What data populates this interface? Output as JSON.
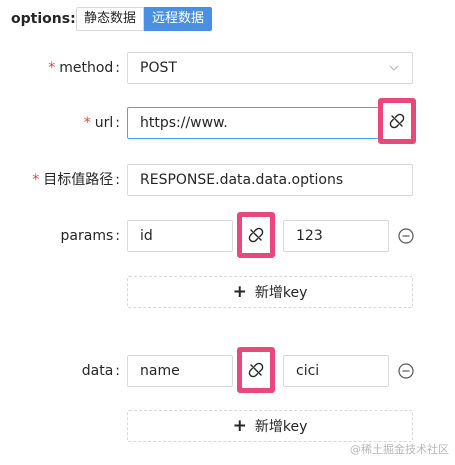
{
  "options": {
    "label": "options",
    "segments": [
      "静态数据",
      "远程数据"
    ],
    "selected": "远程数据"
  },
  "form": {
    "method": {
      "label": "method",
      "required": true,
      "value": "POST"
    },
    "url": {
      "label": "url",
      "required": true,
      "value": "https://www."
    },
    "path": {
      "label": "目标值路径",
      "required": true,
      "value": "RESPONSE.data.data.options"
    },
    "params": {
      "label": "params",
      "rows": [
        {
          "key": "id",
          "value": "123"
        }
      ],
      "add_label": "新增key"
    },
    "data": {
      "label": "data",
      "rows": [
        {
          "key": "name",
          "value": "cici"
        }
      ],
      "add_label": "新增key"
    }
  },
  "watermark": "@稀土掘金技术社区",
  "colors": {
    "accent": "#4a90e2",
    "required": "#e8443a",
    "highlight": "#e8497a"
  }
}
